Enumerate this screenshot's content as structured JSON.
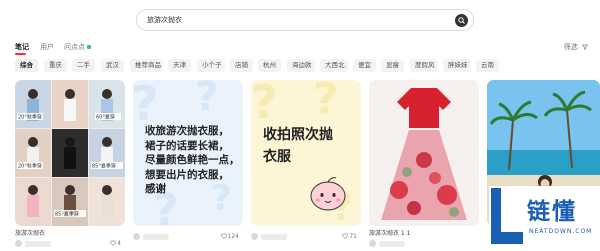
{
  "search": {
    "query": "旅游次抛衣"
  },
  "tabs": [
    {
      "label": "笔记"
    },
    {
      "label": "用户"
    },
    {
      "label": "问点点"
    }
  ],
  "filter_label": "筛选",
  "chips": [
    "综合",
    "重庆",
    "二手",
    "武汉",
    "推荐商品",
    "天津",
    "小个子",
    "店铺",
    "杭州",
    "海边款",
    "大西北",
    "便宜",
    "显瘦",
    "度假风",
    "胖妹妹",
    "云南"
  ],
  "cards": [
    {
      "title": "旅游次抛衣",
      "likes": "4",
      "collage_labels": [
        "20°秋季穿",
        "20°秋季穿",
        "60°夏穿",
        "85°夏季穿",
        "85°夏季穿"
      ]
    },
    {
      "title": "",
      "likes": "124",
      "lines": [
        "收旅游次抛衣服，",
        "裙子的话要长裙，",
        "尽量颜色鲜艳一点，",
        "想要出片的衣服，",
        "感谢"
      ]
    },
    {
      "title": "",
      "likes": "71",
      "lines": [
        "收拍照次抛",
        "衣服"
      ]
    },
    {
      "title": "旅游次抛衣 1 1",
      "likes": ""
    },
    {
      "title": "",
      "likes": ""
    }
  ],
  "watermark": {
    "text": "链懂",
    "sub": "NEATDOWN.COM"
  },
  "colors": {
    "accent": "#ff2442",
    "highlight": "#ff6a3d",
    "watermark": "#1a5fb4"
  }
}
